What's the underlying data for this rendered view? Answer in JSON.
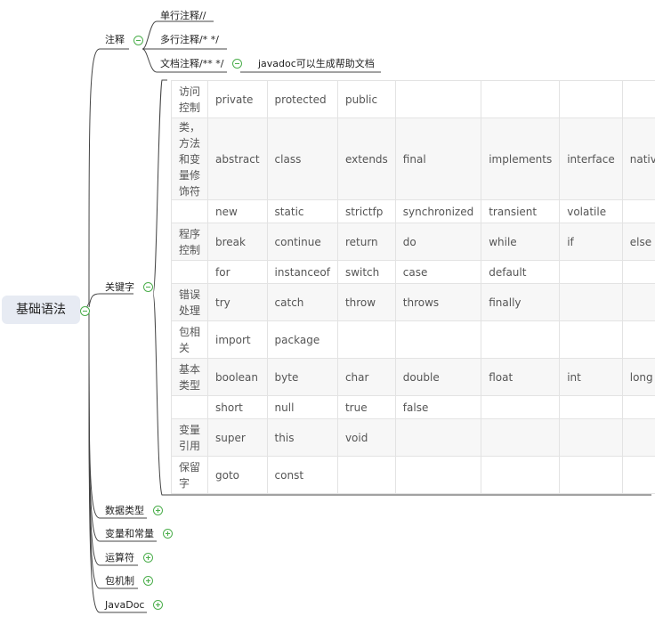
{
  "root": {
    "label": "基础语法"
  },
  "comments": {
    "label": "注释",
    "items": [
      "单行注释//",
      "多行注释/* */",
      "文档注释/** */"
    ],
    "doc_note": "javadoc可以生成帮助文档"
  },
  "keywords": {
    "label": "关键字",
    "rows": [
      {
        "label": "访问\n控制",
        "cells": [
          "private",
          "protected",
          "public",
          "",
          "",
          "",
          ""
        ]
      },
      {
        "label": "类，\n方法\n和变\n量修\n饰符",
        "cells": [
          "abstract",
          "class",
          "extends",
          "final",
          "implements",
          "interface",
          "native"
        ]
      },
      {
        "label": "",
        "cells": [
          "new",
          "static",
          "strictfp",
          "synchronized",
          "transient",
          "volatile",
          ""
        ]
      },
      {
        "label": "程序\n控制",
        "cells": [
          "break",
          "continue",
          "return",
          "do",
          "while",
          "if",
          "else"
        ]
      },
      {
        "label": "",
        "cells": [
          "for",
          "instanceof",
          "switch",
          "case",
          "default",
          "",
          ""
        ]
      },
      {
        "label": "错误\n处理",
        "cells": [
          "try",
          "catch",
          "throw",
          "throws",
          "finally",
          "",
          ""
        ]
      },
      {
        "label": "包相\n关",
        "cells": [
          "import",
          "package",
          "",
          "",
          "",
          "",
          ""
        ]
      },
      {
        "label": "基本\n类型",
        "cells": [
          "boolean",
          "byte",
          "char",
          "double",
          "float",
          "int",
          "long"
        ]
      },
      {
        "label": "",
        "cells": [
          "short",
          "null",
          "true",
          "false",
          "",
          "",
          ""
        ]
      },
      {
        "label": "变量\n引用",
        "cells": [
          "super",
          "this",
          "void",
          "",
          "",
          "",
          ""
        ]
      },
      {
        "label": "保留\n字",
        "cells": [
          "goto",
          "const",
          "",
          "",
          "",
          "",
          ""
        ]
      }
    ]
  },
  "collapsed_topics": [
    "数据类型",
    "变量和常量",
    "运算符",
    "包机制",
    "JavaDoc"
  ],
  "colors": {
    "line": "#444444",
    "toggle": "#4cae4c",
    "root_bg": "#e7ebf3"
  }
}
